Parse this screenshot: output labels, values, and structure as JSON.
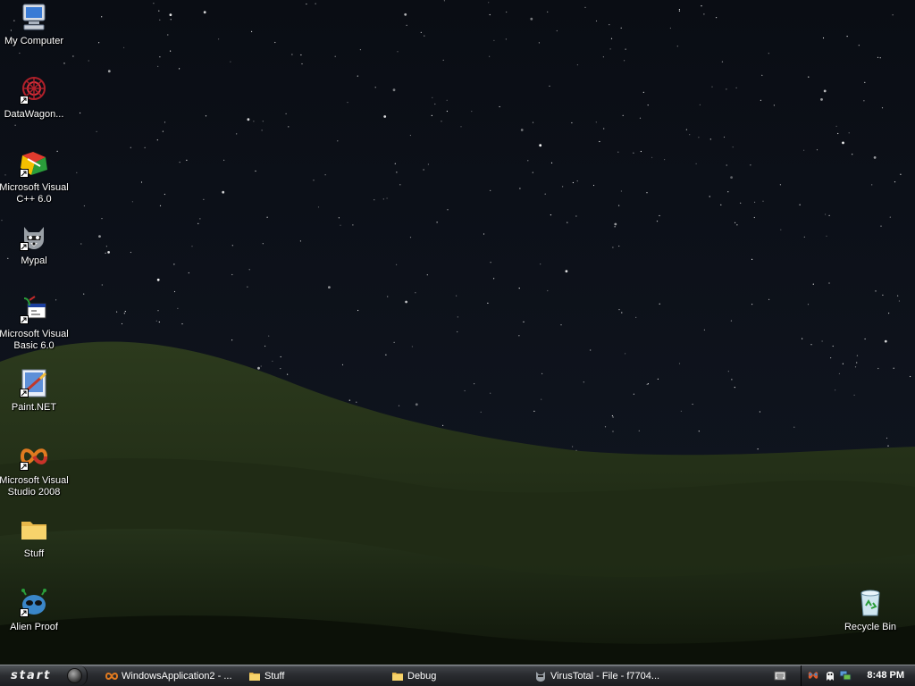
{
  "desktop": {
    "icons": [
      {
        "label": "My Computer",
        "icon": "my-computer-icon"
      },
      {
        "label": "DataWagon...",
        "icon": "datawagon-icon"
      },
      {
        "label": "Microsoft Visual\nC++ 6.0",
        "icon": "visual-cpp-icon"
      },
      {
        "label": "Mypal",
        "icon": "mypal-icon"
      },
      {
        "label": "Microsoft Visual\nBasic 6.0",
        "icon": "visual-basic-icon"
      },
      {
        "label": "Paint.NET",
        "icon": "paint-net-icon"
      },
      {
        "label": "Microsoft Visual\nStudio 2008",
        "icon": "visual-studio-icon"
      },
      {
        "label": "Stuff",
        "icon": "folder-icon"
      },
      {
        "label": "Alien Proof",
        "icon": "alien-proof-icon"
      },
      {
        "label": "Recycle Bin",
        "icon": "recycle-bin-icon"
      }
    ]
  },
  "taskbar": {
    "start_label": "start",
    "tasks": [
      {
        "label": "WindowsApplication2 - ...",
        "icon": "visual-studio-icon"
      },
      {
        "label": "Stuff",
        "icon": "folder-icon"
      },
      {
        "label": "Debug",
        "icon": "folder-icon"
      },
      {
        "label": "VirusTotal - File - f7704...",
        "icon": "mypal-icon"
      }
    ],
    "tray": {
      "icons": [
        "butterfly-icon",
        "ghost-icon",
        "network-icon"
      ],
      "clock": "8:48 PM"
    }
  },
  "colors": {
    "sky": "#05070c",
    "hills": "#1f2a14",
    "taskbar": "#2a2c30",
    "text": "#ffffff"
  }
}
